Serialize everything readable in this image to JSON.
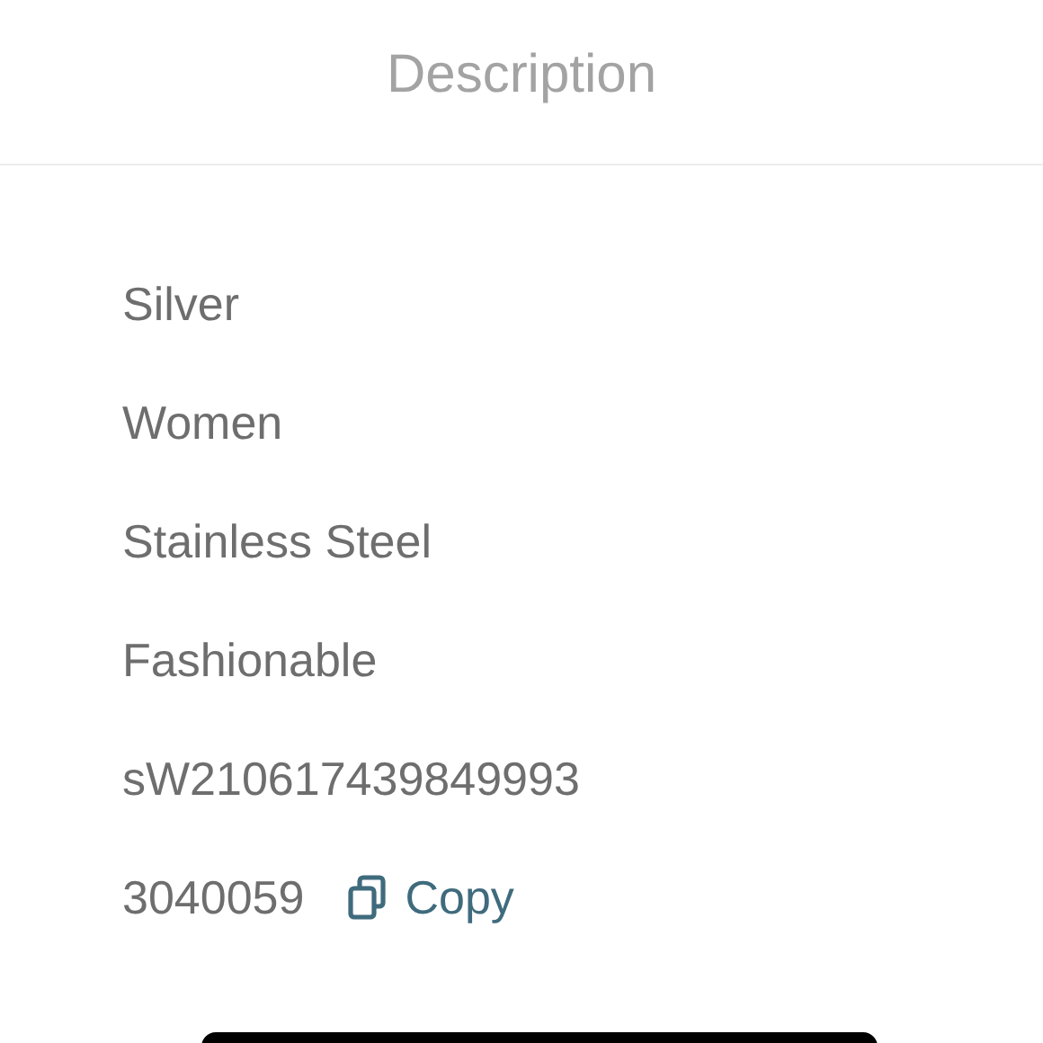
{
  "header": {
    "title": "Description"
  },
  "details": [
    {
      "value": "Silver"
    },
    {
      "value": "Women"
    },
    {
      "value": "Stainless Steel"
    },
    {
      "value": "Fashionable"
    },
    {
      "value": "sW210617439849993"
    }
  ],
  "code_row": {
    "value": "3040059",
    "copy_label": "Copy"
  }
}
